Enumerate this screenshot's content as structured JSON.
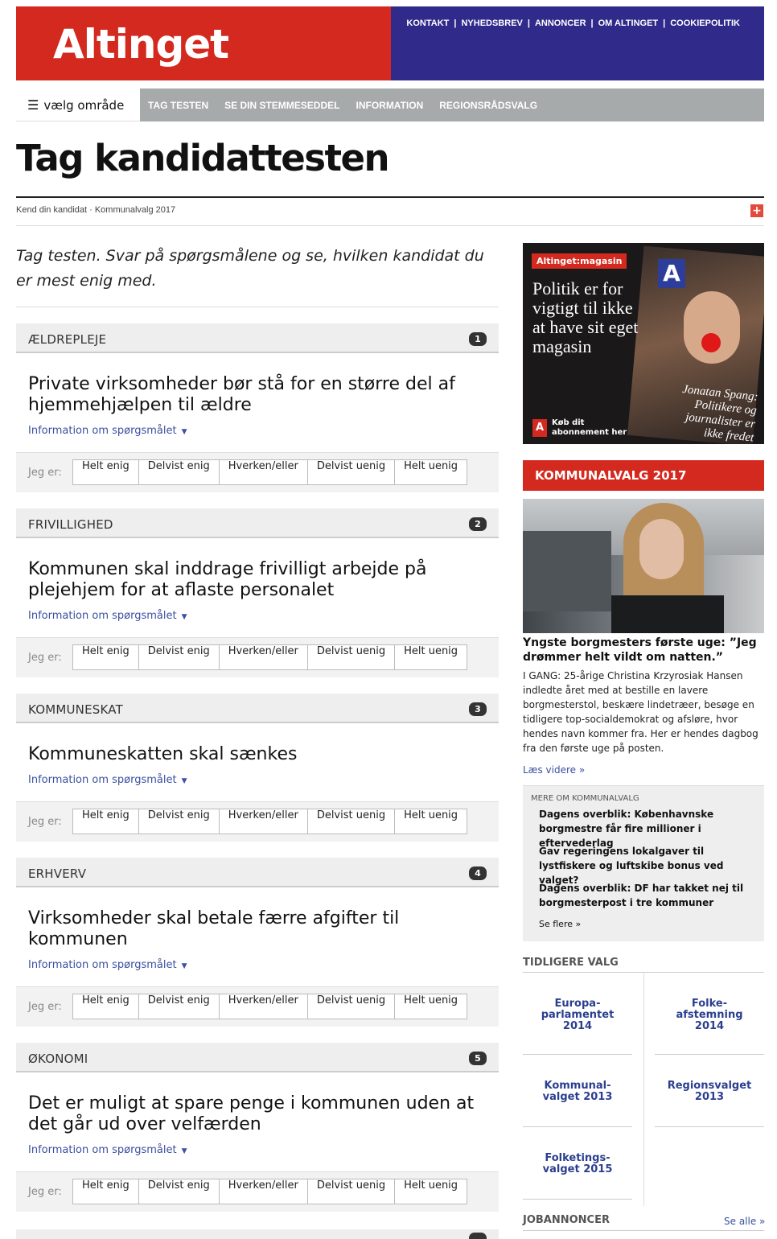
{
  "header": {
    "logo": "Altinget",
    "top_links": [
      "KONTAKT",
      "NYHEDSBREV",
      "ANNONCER",
      "OM ALTINGET",
      "COOKIEPOLITIK"
    ],
    "top_link_separator": "|",
    "colors": {
      "brand_red": "#d4291f",
      "brand_blue": "#302a8b",
      "nav_gray": "#a7aaaa",
      "link_blue": "#3a50a0"
    }
  },
  "nav": {
    "menu_icon": "hamburger-icon",
    "menu_glyph": "☰",
    "menu_label": "vælg område",
    "items": [
      "TAG TESTEN",
      "SE DIN STEMMESEDDEL",
      "INFORMATION",
      "REGIONSRÅDSVALG"
    ]
  },
  "page": {
    "title": "Tag kandidattesten",
    "breadcrumb": "Kend din kandidat · Kommunalvalg 2017",
    "plus_icon": "plus-icon",
    "plus_glyph": "+",
    "intro": "Tag testen. Svar på spørgsmålene og se, hvilken kandidat du er mest enig med."
  },
  "quiz": {
    "info_label": "Information om spørgsmålet",
    "info_caret": "▼",
    "answer_prefix": "Jeg er:",
    "options": [
      "Helt enig",
      "Delvist enig",
      "Hverken/eller",
      "Delvist uenig",
      "Helt uenig"
    ],
    "questions": [
      {
        "category": "ÆLDREPLEJE",
        "number": "1",
        "text": "Private virksomheder bør stå for en større del af hjemmehjælpen til ældre"
      },
      {
        "category": "FRIVILLIGHED",
        "number": "2",
        "text": "Kommunen skal inddrage frivilligt arbejde på plejehjem for at aflaste personalet"
      },
      {
        "category": "KOMMUNESKAT",
        "number": "3",
        "text": "Kommuneskatten skal sænkes"
      },
      {
        "category": "ERHVERV",
        "number": "4",
        "text": "Virksomheder skal betale færre afgifter til kommunen"
      },
      {
        "category": "ØKONOMI",
        "number": "5",
        "text": "Det er muligt at spare penge i kommunen uden at det går ud over velfærden"
      }
    ]
  },
  "sidebar": {
    "magazine": {
      "logo": "Altinget:magasin",
      "logo_letter": "A",
      "headline": "Politik er for vigtigt til ikke at have sit eget magasin",
      "cover_text": "Jonatan Spang: Politikere og journalister er ikke fredet",
      "cta_icon_letter": "A",
      "cta": "Køb dit abonnement her"
    },
    "section_title": "KOMMUNALVALG 2017",
    "article": {
      "title": "Yngste borgmesters første uge: ”Jeg drømmer helt vildt om natten.”",
      "body": "I GANG: 25-årige Christina Krzyrosiak Hansen indledte året med at bestille en lavere borgmesterstol, beskære lindetræer, besøge en tidligere top-socialdemokrat og afsløre, hvor hendes navn kommer fra. Her er hendes dagbog fra den første uge på posten.",
      "read_more": "Læs videre »"
    },
    "more": {
      "heading": "MERE OM KOMMUNALVALG",
      "items": [
        "Dagens overblik: Københavnske borgmestre får fire millioner i eftervederlag",
        "Gav regeringens lokalgaver til lystfiskere og luftskibe bonus ved valget?",
        "Dagens overblik: DF har takket nej til borgmesterpost i tre kommuner"
      ],
      "see_more": "Se flere »"
    },
    "previous": {
      "heading": "TIDLIGERE VALG",
      "items": [
        [
          "Europa-",
          "parlamentet",
          "2014"
        ],
        [
          "Folke-",
          "afstemning",
          "2014"
        ],
        [
          "Kommunal-",
          "valget 2013"
        ],
        [
          "Regionsvalget",
          "2013"
        ],
        [
          "Folketings-",
          "valget 2015"
        ]
      ]
    },
    "jobs": {
      "heading": "JOBANNONCER",
      "see_all": "Se alle »"
    }
  }
}
